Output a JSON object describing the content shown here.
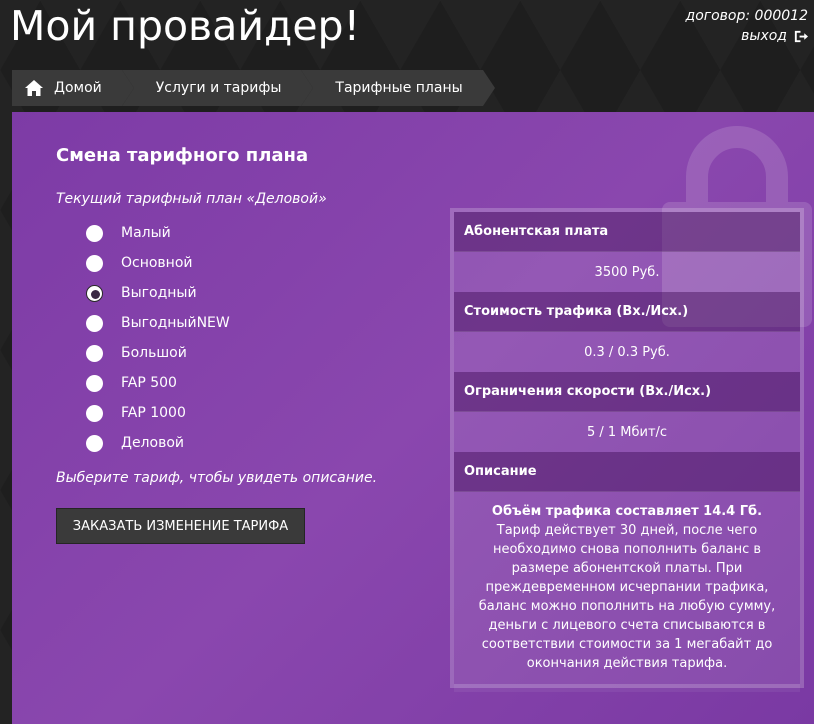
{
  "header": {
    "site_title": "Мой провайдер!",
    "contract_label": "договор: 000012",
    "logout_label": "выход"
  },
  "breadcrumbs": [
    {
      "label": "Домой",
      "icon": "home-icon"
    },
    {
      "label": "Услуги и тарифы"
    },
    {
      "label": "Тарифные планы"
    }
  ],
  "main": {
    "title": "Смена тарифного плана",
    "current_plan": "Текущий тарифный план «Деловой»",
    "plans": [
      {
        "label": "Малый",
        "checked": false
      },
      {
        "label": "Основной",
        "checked": false
      },
      {
        "label": "Выгодный",
        "checked": true
      },
      {
        "label": "ВыгодныйNEW",
        "checked": false
      },
      {
        "label": "Большой",
        "checked": false
      },
      {
        "label": "FAP 500",
        "checked": false
      },
      {
        "label": "FAP 1000",
        "checked": false
      },
      {
        "label": "Деловой",
        "checked": false
      }
    ],
    "hint": "Выберите тариф, чтобы увидеть описание.",
    "order_button": "ЗАКАЗАТЬ ИЗМЕНЕНИЕ ТАРИФА"
  },
  "info": {
    "fee_header": "Абонентская плата",
    "fee_value": "3500 Руб.",
    "traffic_header": "Стоимость трафика (Вх./Исх.)",
    "traffic_value": "0.3 / 0.3 Руб.",
    "speed_header": "Ограничения скорости (Вх./Исх.)",
    "speed_value": "5 / 1 Мбит/с",
    "desc_header": "Описание",
    "desc_bold": "Объём трафика составляет 14.4 Гб.",
    "desc_text": "Тариф действует 30 дней, после чего необходимо снова пополнить баланс в размере абонентской платы. При преждевременном исчерпании трафика, баланс можно пополнить на любую сумму, деньги с лицевого счета списываются в соответствии стоимости за 1 мегабайт до окончания действия тарифа."
  },
  "colors": {
    "background": "#1e1e1e",
    "panel": "#8a47ae",
    "breadcrumb": "#3a3a3a",
    "button": "#3a3a3a"
  }
}
